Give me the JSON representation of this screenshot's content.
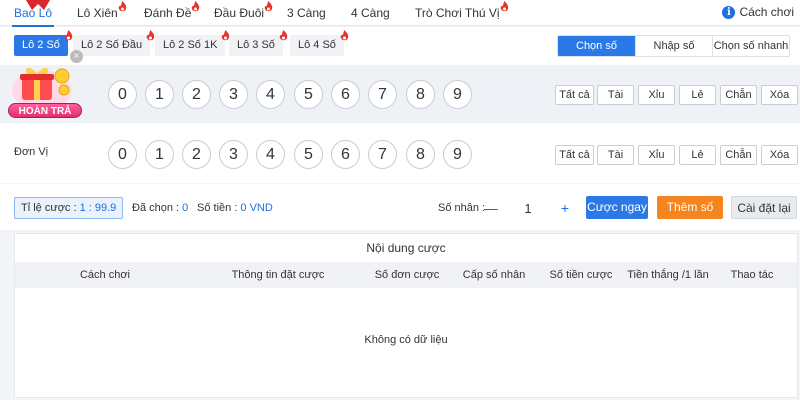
{
  "top_tabs": [
    {
      "label": "Bao Lô",
      "hot": false,
      "active": true
    },
    {
      "label": "Lô Xiên",
      "hot": true
    },
    {
      "label": "Đánh Đề",
      "hot": true
    },
    {
      "label": "Đầu Đuôi",
      "hot": true
    },
    {
      "label": "3 Càng",
      "hot": false
    },
    {
      "label": "4 Càng",
      "hot": false
    },
    {
      "label": "Trò Chơi Thú Vị",
      "hot": true
    }
  ],
  "help": {
    "label": "Cách chơi",
    "icon": "info-icon"
  },
  "sub_tabs": [
    {
      "label": "Lô 2 Số",
      "active": true
    },
    {
      "label": "Lô 2 Số Đầu"
    },
    {
      "label": "Lô 2 Số 1K"
    },
    {
      "label": "Lô 3 Số"
    },
    {
      "label": "Lô 4 Số"
    }
  ],
  "modes": [
    {
      "label": "Chọn số",
      "active": true
    },
    {
      "label": "Nhập số"
    },
    {
      "label": "Chọn số nhanh"
    }
  ],
  "badge": {
    "label": "HOÀN TRẢ"
  },
  "rows": [
    {
      "label": "",
      "digits": [
        "0",
        "1",
        "2",
        "3",
        "4",
        "5",
        "6",
        "7",
        "8",
        "9"
      ]
    },
    {
      "label": "Đơn Vị",
      "digits": [
        "0",
        "1",
        "2",
        "3",
        "4",
        "5",
        "6",
        "7",
        "8",
        "9"
      ]
    }
  ],
  "quick_buttons": [
    "Tất cả",
    "Tài",
    "Xỉu",
    "Lẻ",
    "Chẵn",
    "Xóa"
  ],
  "control": {
    "rate_label": "Tỉ lệ cược :",
    "rate_value": "1 : 99.9",
    "chosen_label": "Đã chọn :",
    "chosen_value": "0",
    "amount_label": "Số tiền :",
    "amount_value": "0 VND",
    "multiplier_label": "Số nhân :",
    "multiplier_value": "1",
    "minus": "—",
    "plus": "+",
    "bet_now": "Cược ngay",
    "add_number": "Thêm số",
    "reset": "Cài đặt lại"
  },
  "table": {
    "title": "Nội dung cược",
    "columns": [
      "Cách chơi",
      "Thông tin đặt cược",
      "Số đơn cược",
      "Cấp số nhân",
      "Số tiền cược",
      "Tiền thắng /1 lần",
      "Thao tác"
    ],
    "empty": "Không có dữ liệu"
  },
  "colors": {
    "accent": "#2b79e6",
    "orange": "#f5851f",
    "hot": "#e8332f"
  }
}
